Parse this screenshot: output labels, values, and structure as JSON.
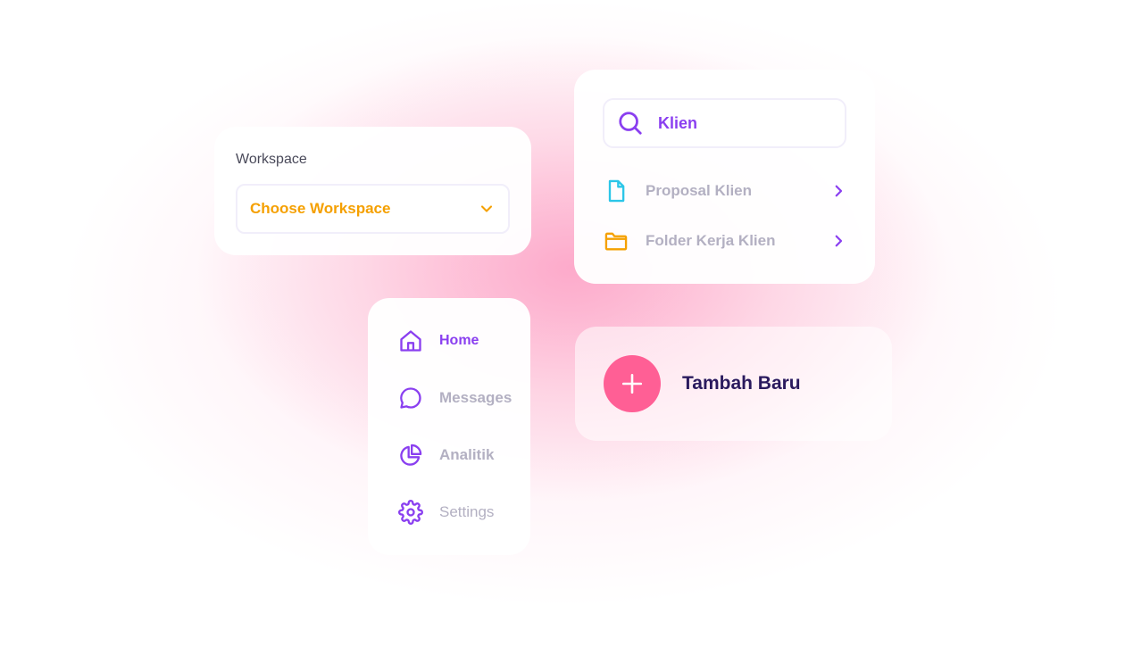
{
  "colors": {
    "accent_purple": "#8A3FF0",
    "accent_orange": "#F5A000",
    "accent_cyan": "#2CC6E8",
    "accent_pink": "#FF5F95",
    "muted_text": "#B3B0C2",
    "dark_text": "#2A1A5E"
  },
  "workspace": {
    "label": "Workspace",
    "selected": "Choose Workspace",
    "icon": "chevron-down-icon"
  },
  "search": {
    "icon": "search-icon",
    "value": "Klien",
    "results": [
      {
        "label": "Proposal Klien",
        "icon": "file-icon",
        "chevron": "chevron-right-icon"
      },
      {
        "label": "Folder Kerja Klien",
        "icon": "folder-icon",
        "chevron": "chevron-right-icon"
      }
    ]
  },
  "nav": {
    "items": [
      {
        "label": "Home",
        "icon": "home-icon",
        "active": true
      },
      {
        "label": "Messages",
        "icon": "message-icon",
        "active": false
      },
      {
        "label": "Analitik",
        "icon": "pie-chart-icon",
        "active": false
      },
      {
        "label": "Settings",
        "icon": "gear-icon",
        "active": false
      }
    ]
  },
  "add_new": {
    "label": "Tambah Baru",
    "icon": "plus-icon"
  }
}
